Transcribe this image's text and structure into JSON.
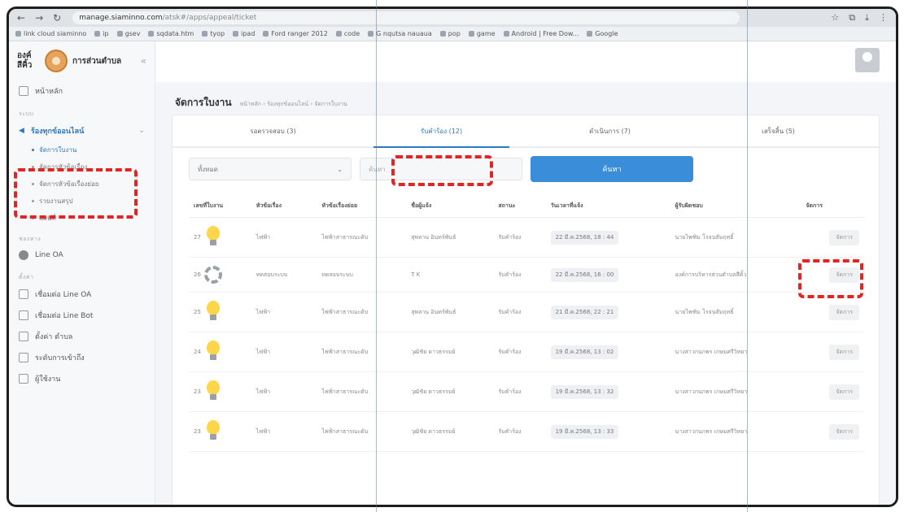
{
  "browser": {
    "url_host": "manage.siaminno.com",
    "url_path": "/atsk#/apps/appeal/ticket",
    "bookmarks": [
      "link cloud siaminno",
      "ip",
      "gsev",
      "sqdata.htm",
      "tyop",
      "ipad",
      "Ford ranger 2012",
      "code",
      "G nqutsa nauaua",
      "pop",
      "game",
      "Android | Free Dow...",
      "Google"
    ]
  },
  "sidebar": {
    "brand_prefix": "องค์",
    "brand_title": "การส่วนตำบล",
    "brand_suffix": "สีคิ้ว",
    "home": "หน้าหลัก",
    "section_main": "ระบบ",
    "active_menu": "ร้องทุกข์ออนไลน์",
    "sub_items": [
      "จัดการใบงาน",
      "จัดการหัวข้อเรื่อง",
      "จัดการหัวข้อเรื่องย่อย",
      "รายงานสรุป",
      "แผนที่"
    ],
    "section_contact": "ช่องทาง",
    "line_oa": "Line OA",
    "section_settings": "ตั้งค่า",
    "settings_items": [
      "เชื่อมต่อ Line OA",
      "เชื่อมต่อ Line Bot",
      "ตั้งค่า ตำบล",
      "ระดับการเข้าถึง",
      "ผู้ใช้งาน"
    ]
  },
  "header": {
    "title": "จัดการใบงาน",
    "breadcrumb": "หน้าหลัก  ›  ร้องทุกข์ออนไลน์  ›  จัดการใบงาน"
  },
  "tabs": [
    {
      "label": "รอตรวจสอบ (3)"
    },
    {
      "label": "รับคำร้อง (12)"
    },
    {
      "label": "ดำเนินการ (7)"
    },
    {
      "label": "เสร็จสิ้น (5)"
    }
  ],
  "filters": {
    "select_value": "ทั้งหมด",
    "search_placeholder": "ค้นหา",
    "search_button": "ค้นหา"
  },
  "table": {
    "headers": [
      "เลขที่ใบงาน",
      "หัวข้อเรื่อง",
      "หัวข้อเรื่องย่อย",
      "ชื่อผู้แจ้ง",
      "สถานะ",
      "วันเวลาที่แจ้ง",
      "ผู้รับผิดชอบ",
      "จัดการ"
    ],
    "rows": [
      {
        "id": "27",
        "icon": "bulb-icon",
        "topic": "ไฟฟ้า",
        "subtopic": "ไฟฟ้าสาธารณะดับ",
        "reporter": "สุพลาน อินทร์พันธ์",
        "status": "รับคำร้อง",
        "time": "22 มี.ค.2568, 18 : 44",
        "owner": "นายไพฑิม โรจนสัมฤทธิ์",
        "action": "จัดการ"
      },
      {
        "id": "26",
        "icon": "gear-icon",
        "topic": "ทดสอบระบบ",
        "subtopic": "ทดสอบระบบ",
        "reporter": "T K",
        "status": "รับคำร้อง",
        "time": "22 มี.ค.2568, 16 : 00",
        "owner": "องค์การบริหารส่วนตำบลสีคิ้ว",
        "action": "จัดการ"
      },
      {
        "id": "25",
        "icon": "bulb-icon",
        "topic": "ไฟฟ้า",
        "subtopic": "ไฟฟ้าสาธารณะดับ",
        "reporter": "สุพลาน อินทร์พันธ์",
        "status": "รับคำร้อง",
        "time": "21 มี.ค.2568, 22 : 21",
        "owner": "นายไพฑิม โรจนสัมฤทธิ์",
        "action": "จัดการ"
      },
      {
        "id": "24",
        "icon": "bulb-icon",
        "topic": "ไฟฟ้า",
        "subtopic": "ไฟฟ้าสาธารณะดับ",
        "reporter": "วุฒิชัย ดาวธรรมย์",
        "status": "รับคำร้อง",
        "time": "19 มี.ค.2568, 13 : 02",
        "owner": "นางสาวกนกพร เกษมศรีวิทยา",
        "action": "จัดการ"
      },
      {
        "id": "23",
        "icon": "bulb-icon",
        "topic": "ไฟฟ้า",
        "subtopic": "ไฟฟ้าสาธารณะดับ",
        "reporter": "วุฒิชัย ดาวธรรมย์",
        "status": "รับคำร้อง",
        "time": "19 มี.ค.2568, 13 : 32",
        "owner": "นางสาวกนกพร เกษมศรีวิทยา",
        "action": "จัดการ"
      },
      {
        "id": "23",
        "icon": "bulb-icon",
        "topic": "ไฟฟ้า",
        "subtopic": "ไฟฟ้าสาธารณะดับ",
        "reporter": "วุฒิชัย ดาวธรรมย์",
        "status": "รับคำร้อง",
        "time": "19 มี.ค.2568, 13 : 33",
        "owner": "นางสาวกนกพร เกษมศรีวิทยา",
        "action": "จัดการ"
      }
    ]
  },
  "colors": {
    "accent": "#3a8dd8",
    "highlight": "#e02525"
  }
}
